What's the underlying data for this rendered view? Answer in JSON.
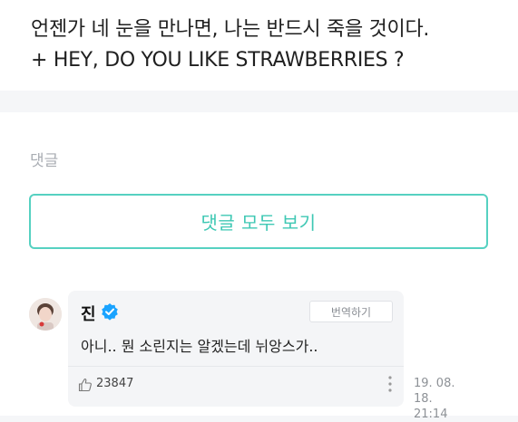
{
  "post": {
    "line1": "언젠가 네 눈을 만나면, 나는 반드시 죽을 것이다.",
    "line2": "+ HEY, DO YOU LIKE STRAWBERRIES ?"
  },
  "comments": {
    "heading": "댓글",
    "view_all_label": "댓글 모두 보기",
    "items": [
      {
        "author": "진",
        "verified": true,
        "translate_label": "번역하기",
        "text": "아니.. 뭔 소린지는 알겠는데 뉘앙스가..",
        "likes": "23847",
        "date": "19. 08. 18.",
        "time": "21:14"
      }
    ]
  },
  "colors": {
    "accent": "#3fc8b4",
    "verified": "#1aa3ff"
  }
}
